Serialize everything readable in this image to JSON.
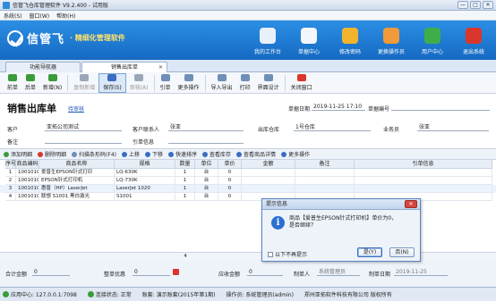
{
  "window": {
    "title": "信管飞仓库管理软件 V9.2.400 - 试用版",
    "controls": [
      "—",
      "□",
      "✕"
    ]
  },
  "menu": [
    "系统(S)",
    "窗口(W)",
    "帮助(H)"
  ],
  "banner": {
    "brand": "信管飞",
    "slogan": "· 精细化管理软件",
    "nav": [
      {
        "label": "我的工作台",
        "icon": "monitor-icon",
        "color": "#e8f0fa"
      },
      {
        "label": "单据中心",
        "icon": "document-list-icon",
        "color": "#f3f6fa"
      },
      {
        "label": "修改密码",
        "icon": "key-icon",
        "color": "#f2b42c"
      },
      {
        "label": "更换操作员",
        "icon": "user-icon",
        "color": "#f09a3a"
      },
      {
        "label": "用户中心",
        "icon": "globe-icon",
        "color": "#3fae49"
      },
      {
        "label": "退出系统",
        "icon": "power-icon",
        "color": "#d9362c"
      }
    ]
  },
  "tabs": [
    {
      "label": "功能导航器"
    },
    {
      "label": "销售出库单",
      "active": true,
      "close": "✕"
    }
  ],
  "toolbar": [
    {
      "label": "前单",
      "icon": "arrow-left-icon",
      "color": "#3a9b3a"
    },
    {
      "label": "后单",
      "icon": "arrow-right-icon",
      "color": "#3a9b3a"
    },
    {
      "label": "新增(N)",
      "icon": "plus-icon",
      "color": "#3a9b3a"
    },
    {
      "label": "复制新增",
      "icon": "copy-icon",
      "color": "#9aa7b8",
      "disabled": true
    },
    {
      "label": "保存(S)",
      "icon": "save-icon",
      "color": "#3b6ec2",
      "pressed": true
    },
    {
      "label": "审核(A)",
      "icon": "check-icon",
      "color": "#9aa7b8",
      "disabled": true
    },
    {
      "label": "引单",
      "icon": "import-icon",
      "color": "#6f8fb8"
    },
    {
      "label": "更多操作",
      "icon": "more-icon",
      "color": "#6f8fb8"
    },
    {
      "label": "导入导出",
      "icon": "import-export-icon",
      "color": "#6f8fb8"
    },
    {
      "label": "打印",
      "icon": "print-icon",
      "color": "#6f8fb8"
    },
    {
      "label": "界面设计",
      "icon": "layout-icon",
      "color": "#6f8fb8"
    },
    {
      "label": "关闭窗口",
      "icon": "close-window-icon",
      "color": "#d9362c"
    }
  ],
  "doc": {
    "title": "销售出库单",
    "status": "待审核",
    "date_label": "单据日期",
    "date_value": "2019-11-25 17:10",
    "number_label": "单据编号",
    "number_value": "",
    "customer_label": "客户",
    "customer_value": "亚拓公司测试",
    "contact_label": "客户联系人",
    "contact_value": "张亚",
    "warehouse_label": "出库仓库",
    "warehouse_value": "1号仓库",
    "salesman_label": "业务员",
    "salesman_value": "张亚",
    "remark_label": "备注",
    "remark_value": "",
    "ref_label": "引单信息",
    "ref_value": ""
  },
  "grid_tools": [
    {
      "label": "添加明细",
      "icon": "add-row-icon",
      "color": "#3a9b3a"
    },
    {
      "label": "删除明细",
      "icon": "delete-row-icon",
      "color": "#d9362c"
    },
    {
      "label": "扫描条形码(F4)",
      "icon": "barcode-icon",
      "color": "#6f8fb8"
    },
    {
      "label": "上移",
      "icon": "move-up-icon",
      "color": "#3b6ec2"
    },
    {
      "label": "下移",
      "icon": "move-down-icon",
      "color": "#3b6ec2"
    },
    {
      "label": "快速排序",
      "icon": "sort-icon",
      "color": "#3b6ec2"
    },
    {
      "label": "查看库存",
      "icon": "stock-icon",
      "color": "#3b6ec2"
    },
    {
      "label": "查看商品详情",
      "icon": "detail-icon",
      "color": "#3b6ec2"
    },
    {
      "label": "更多操作",
      "icon": "more-icon",
      "color": "#3b6ec2"
    }
  ],
  "grid": {
    "headers": [
      "序号",
      "商品编码",
      "商品名称",
      "规格",
      "数量",
      "单位",
      "单价",
      "金额",
      "备注",
      "引单信息"
    ],
    "rows": [
      [
        "1",
        "100101001",
        "爱普生EPSON针式打印",
        "LQ-630K",
        "1",
        "台",
        "0",
        "",
        "",
        ""
      ],
      [
        "2",
        "100101002",
        "EPSON针式打印机",
        "LQ-730K",
        "1",
        "台",
        "0",
        "",
        "",
        ""
      ],
      [
        "3",
        "100101003",
        "惠普（HP）LaserJet",
        "LaserJet 1020",
        "1",
        "台",
        "0",
        "",
        "",
        ""
      ],
      [
        "4",
        "100101004",
        "联想 S1001 黑白激光",
        "S1001",
        "1",
        "台",
        "0",
        "",
        "",
        ""
      ]
    ],
    "total_qty": "4",
    "total_amount": "0"
  },
  "footer": {
    "total_label": "合计金额",
    "total_value": "0",
    "discount_label": "整单优惠",
    "discount_value": "0",
    "receivable_label": "应收金额",
    "receivable_value": "0",
    "creator_label": "制单人",
    "creator_value": "系统管理员",
    "create_date_label": "制单日期",
    "create_date_value": "2019-11-25"
  },
  "dialog": {
    "title": "提示信息",
    "close": "✕",
    "message": "商品【爱普生EPSON针式打印机】单价为0，\n是否继续？",
    "checkbox_label": "以下不再提示",
    "yes_label": "是(Y)",
    "no_label": "否(N)"
  },
  "statusbar": [
    {
      "label": "应用中心: 127.0.0.1:7098",
      "icon": "app-center-icon",
      "color": "#3a9b3a"
    },
    {
      "label": "连接状态: 正常",
      "icon": "connection-icon",
      "color": "#3a9b3a"
    },
    {
      "label": "账套: 演示账套(2015年第1期)",
      "icon": "",
      "color": ""
    },
    {
      "label": "操作员: 系统管理员(admin)",
      "icon": "",
      "color": ""
    },
    {
      "label": "郑州亚拓软件科技有限公司 版权所有",
      "icon": "",
      "color": ""
    }
  ]
}
